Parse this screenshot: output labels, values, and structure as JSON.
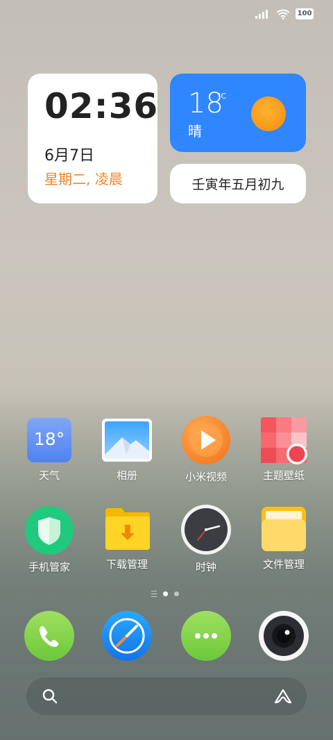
{
  "status_bar": {
    "battery": "100"
  },
  "clock_widget": {
    "time": "02:36",
    "date": "6月7日",
    "weekday": "星期二, 凌晨"
  },
  "weather_widget": {
    "temperature": "18",
    "unit": "°C",
    "condition": "晴"
  },
  "lunar_widget": {
    "text": "壬寅年五月初九"
  },
  "apps_row1": [
    {
      "label": "天气",
      "icon": "weather-app-icon",
      "badge": "18°"
    },
    {
      "label": "相册",
      "icon": "gallery-app-icon"
    },
    {
      "label": "小米视频",
      "icon": "video-app-icon"
    },
    {
      "label": "主题壁纸",
      "icon": "themes-app-icon"
    }
  ],
  "apps_row2": [
    {
      "label": "手机管家",
      "icon": "security-app-icon"
    },
    {
      "label": "下载管理",
      "icon": "downloads-app-icon"
    },
    {
      "label": "时钟",
      "icon": "clock-app-icon"
    },
    {
      "label": "文件管理",
      "icon": "file-manager-app-icon"
    }
  ],
  "page_indicator": {
    "pages": 2,
    "active": 1
  },
  "dock": [
    {
      "icon": "phone-app-icon"
    },
    {
      "icon": "browser-app-icon"
    },
    {
      "icon": "messages-app-icon"
    },
    {
      "icon": "camera-app-icon"
    }
  ],
  "search_bar": {
    "icons": [
      "search-icon",
      "voice-assistant-icon"
    ]
  },
  "colors": {
    "accent_orange": "#f0852a",
    "weather_blue": "#2f86ff"
  }
}
